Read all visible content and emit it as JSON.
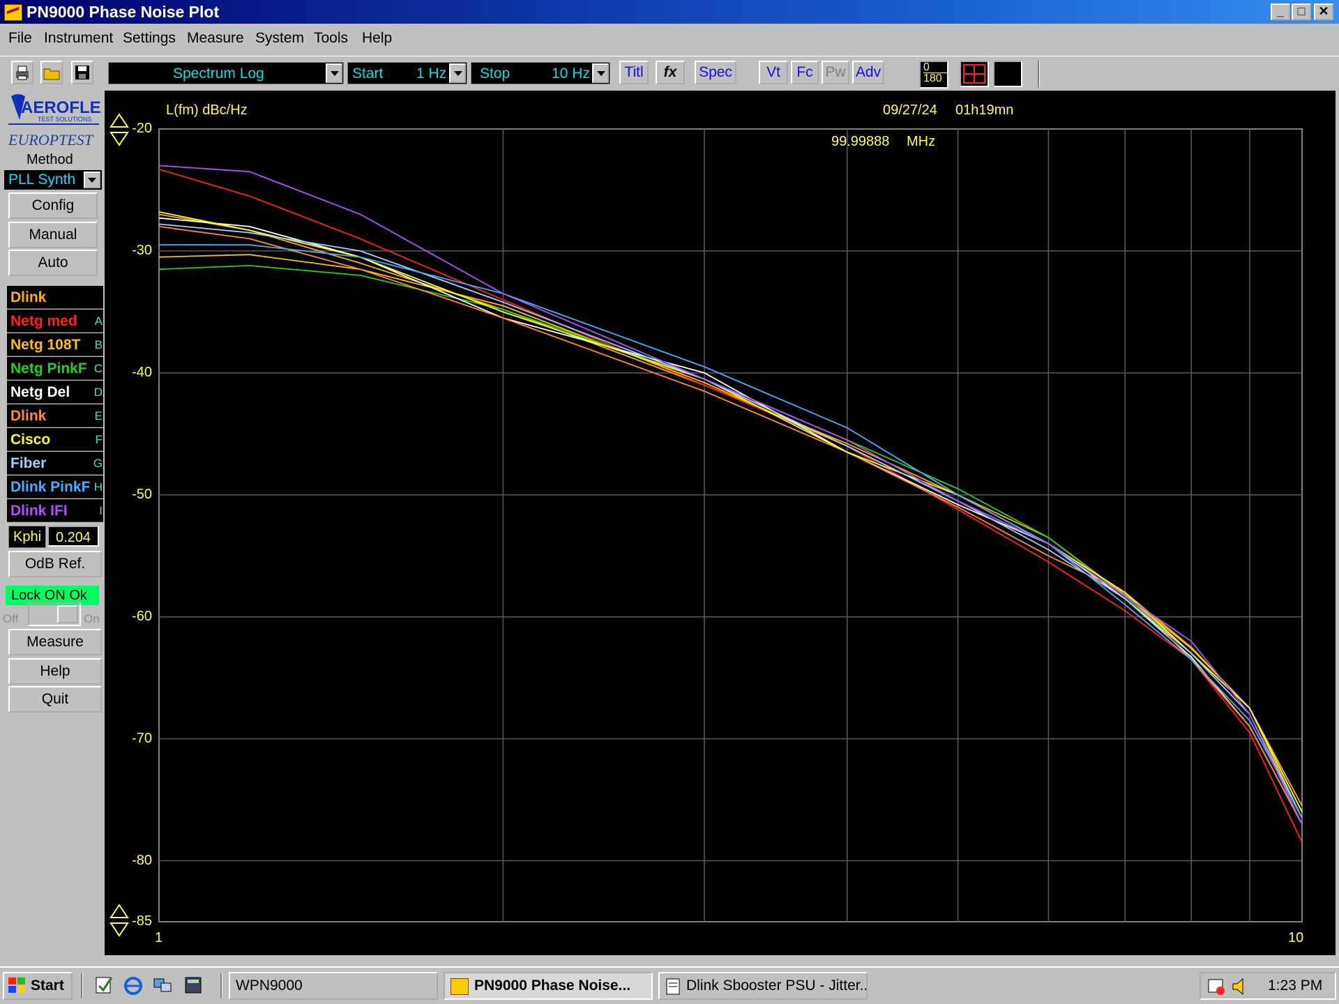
{
  "window": {
    "title": "PN9000 Phase Noise Plot",
    "controls": [
      "_",
      "□",
      "✕"
    ]
  },
  "menu": [
    "File",
    "Instrument",
    "Settings",
    "Measure",
    "System",
    "Tools",
    "Help"
  ],
  "toolbar": {
    "mode": "Spectrum Log",
    "start_label": "Start",
    "start_value": "1 Hz",
    "stop_label": "Stop",
    "stop_value": "10 Hz",
    "buttons": [
      "Titl",
      "fx",
      "Spec",
      "Vt",
      "Fc",
      "Pw",
      "Adv"
    ],
    "phase_top": "0",
    "phase_bottom": "180"
  },
  "left_panel": {
    "brand": "AEROFLEX",
    "brand_sub": "TEST SOLUTIONS",
    "brand2": "EUROPTEST",
    "method_label": "Method",
    "method_value": "PLL Synth",
    "buttons": [
      "Config",
      "Manual",
      "Auto"
    ],
    "traces": [
      {
        "name": "Dlink",
        "tag": "",
        "color": "#ffb000"
      },
      {
        "name": "Netg med",
        "tag": "A",
        "color": "#ff2020"
      },
      {
        "name": "Netg 108T",
        "tag": "B",
        "color": "#ffc000"
      },
      {
        "name": "Netg PinkF",
        "tag": "C",
        "color": "#20d020"
      },
      {
        "name": "Netg Del",
        "tag": "D",
        "color": "#ffffff"
      },
      {
        "name": "Dlink",
        "tag": "E",
        "color": "#ff8c30"
      },
      {
        "name": "Cisco",
        "tag": "F",
        "color": "#ffff20"
      },
      {
        "name": "Fiber",
        "tag": "G",
        "color": "#a0d0ff"
      },
      {
        "name": "Dlink PinkF",
        "tag": "H",
        "color": "#40b0ff"
      },
      {
        "name": "Dlink IFI",
        "tag": "I",
        "color": "#b050ff"
      }
    ],
    "kphi_label": "Kphi",
    "kphi_value": "0.204",
    "odb_button": "OdB Ref.",
    "lock_status": "Lock ON Ok",
    "switch_off": "Off",
    "switch_on": "On",
    "buttons2": [
      "Measure",
      "Help",
      "Quit"
    ]
  },
  "plot": {
    "ylabel": "L(fm) dBc/Hz",
    "date": "09/27/24",
    "time": "01h19mn",
    "frequency": "99.99888",
    "freq_unit": "MHz"
  },
  "taskbar": {
    "start": "Start",
    "tasks": [
      "WPN9000",
      "PN9000 Phase Noise...",
      "Dlink Sbooster PSU - Jitter..."
    ],
    "clock": "1:23 PM"
  },
  "chart_data": {
    "type": "line",
    "xlabel": "",
    "ylabel": "L(fm) dBc/Hz",
    "x_scale": "log",
    "xlim": [
      1,
      10
    ],
    "ylim": [
      -85,
      -20
    ],
    "y_ticks": [
      -20,
      -30,
      -40,
      -50,
      -60,
      -70,
      -80,
      -85
    ],
    "x_ticks": [
      1,
      10
    ],
    "grid": true,
    "x": [
      1.0,
      1.2,
      1.5,
      2.0,
      3.0,
      4.0,
      5.0,
      6.0,
      7.0,
      8.0,
      9.0,
      10.0
    ],
    "series": [
      {
        "name": "Dlink",
        "color": "#ffb000",
        "values": [
          -27.0,
          -28.3,
          -31.0,
          -34.8,
          -41.0,
          -45.8,
          -50.0,
          -53.5,
          -58.2,
          -62.6,
          -67.5,
          -75.5
        ]
      },
      {
        "name": "Netg med",
        "color": "#ff2020",
        "values": [
          -23.3,
          -25.5,
          -29.0,
          -34.0,
          -41.0,
          -46.0,
          -51.2,
          -55.5,
          -59.5,
          -63.5,
          -69.5,
          -78.5
        ]
      },
      {
        "name": "Netg 108T",
        "color": "#ffc000",
        "values": [
          -30.5,
          -30.3,
          -31.5,
          -34.5,
          -40.8,
          -46.0,
          -50.5,
          -54.0,
          -58.0,
          -62.5,
          -67.5,
          -76.5
        ]
      },
      {
        "name": "Netg PinkF",
        "color": "#20d020",
        "values": [
          -31.5,
          -31.2,
          -32.0,
          -34.8,
          -40.5,
          -45.5,
          -49.5,
          -53.5,
          -58.3,
          -63.0,
          -67.5,
          -76.0
        ]
      },
      {
        "name": "Netg Del",
        "color": "#ffffff",
        "values": [
          -27.3,
          -28.0,
          -30.5,
          -35.5,
          -40.0,
          -46.5,
          -50.8,
          -54.0,
          -58.5,
          -63.3,
          -69.0,
          -77.0
        ]
      },
      {
        "name": "Dlink",
        "color": "#ff8c30",
        "values": [
          -28.0,
          -29.0,
          -31.5,
          -35.5,
          -41.5,
          -46.5,
          -51.0,
          -55.0,
          -58.0,
          -63.5,
          -69.0,
          -77.0
        ]
      },
      {
        "name": "Cisco",
        "color": "#ffff20",
        "values": [
          -26.8,
          -28.3,
          -30.5,
          -35.0,
          -40.5,
          -46.5,
          -50.0,
          -54.0,
          -58.0,
          -63.0,
          -67.5,
          -76.0
        ]
      },
      {
        "name": "Fiber",
        "color": "#a0d0ff",
        "values": [
          -27.8,
          -28.5,
          -30.0,
          -34.2,
          -40.5,
          -46.0,
          -50.5,
          -54.5,
          -58.5,
          -63.0,
          -68.0,
          -76.5
        ]
      },
      {
        "name": "Dlink PinkF",
        "color": "#40b0ff",
        "values": [
          -29.5,
          -29.5,
          -30.5,
          -33.5,
          -39.5,
          -44.5,
          -50.0,
          -54.0,
          -59.0,
          -63.5,
          -68.5,
          -76.5
        ]
      },
      {
        "name": "Dlink IFI",
        "color": "#b050ff",
        "values": [
          -23.0,
          -23.5,
          -27.0,
          -33.5,
          -40.5,
          -45.5,
          -50.5,
          -54.0,
          -58.3,
          -62.0,
          -68.0,
          -77.0
        ]
      }
    ]
  }
}
